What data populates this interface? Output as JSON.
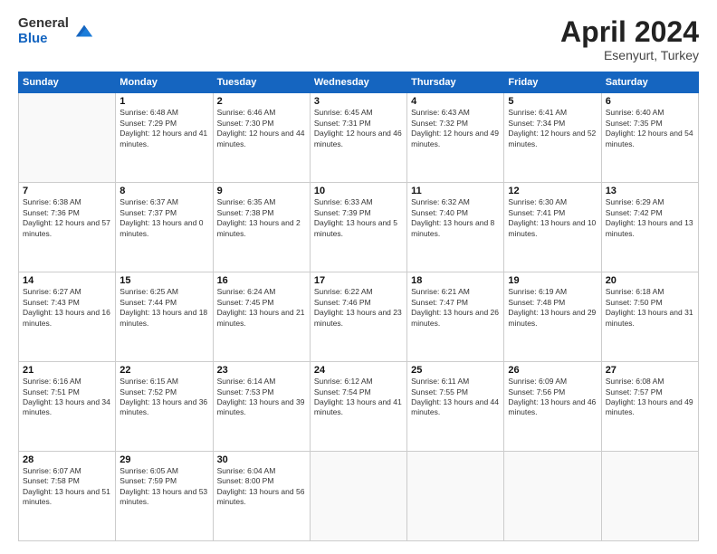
{
  "header": {
    "logo_general": "General",
    "logo_blue": "Blue",
    "title": "April 2024",
    "location": "Esenyurt, Turkey"
  },
  "days_of_week": [
    "Sunday",
    "Monday",
    "Tuesday",
    "Wednesday",
    "Thursday",
    "Friday",
    "Saturday"
  ],
  "weeks": [
    [
      {
        "day": "",
        "sunrise": "",
        "sunset": "",
        "daylight": ""
      },
      {
        "day": "1",
        "sunrise": "Sunrise: 6:48 AM",
        "sunset": "Sunset: 7:29 PM",
        "daylight": "Daylight: 12 hours and 41 minutes."
      },
      {
        "day": "2",
        "sunrise": "Sunrise: 6:46 AM",
        "sunset": "Sunset: 7:30 PM",
        "daylight": "Daylight: 12 hours and 44 minutes."
      },
      {
        "day": "3",
        "sunrise": "Sunrise: 6:45 AM",
        "sunset": "Sunset: 7:31 PM",
        "daylight": "Daylight: 12 hours and 46 minutes."
      },
      {
        "day": "4",
        "sunrise": "Sunrise: 6:43 AM",
        "sunset": "Sunset: 7:32 PM",
        "daylight": "Daylight: 12 hours and 49 minutes."
      },
      {
        "day": "5",
        "sunrise": "Sunrise: 6:41 AM",
        "sunset": "Sunset: 7:34 PM",
        "daylight": "Daylight: 12 hours and 52 minutes."
      },
      {
        "day": "6",
        "sunrise": "Sunrise: 6:40 AM",
        "sunset": "Sunset: 7:35 PM",
        "daylight": "Daylight: 12 hours and 54 minutes."
      }
    ],
    [
      {
        "day": "7",
        "sunrise": "Sunrise: 6:38 AM",
        "sunset": "Sunset: 7:36 PM",
        "daylight": "Daylight: 12 hours and 57 minutes."
      },
      {
        "day": "8",
        "sunrise": "Sunrise: 6:37 AM",
        "sunset": "Sunset: 7:37 PM",
        "daylight": "Daylight: 13 hours and 0 minutes."
      },
      {
        "day": "9",
        "sunrise": "Sunrise: 6:35 AM",
        "sunset": "Sunset: 7:38 PM",
        "daylight": "Daylight: 13 hours and 2 minutes."
      },
      {
        "day": "10",
        "sunrise": "Sunrise: 6:33 AM",
        "sunset": "Sunset: 7:39 PM",
        "daylight": "Daylight: 13 hours and 5 minutes."
      },
      {
        "day": "11",
        "sunrise": "Sunrise: 6:32 AM",
        "sunset": "Sunset: 7:40 PM",
        "daylight": "Daylight: 13 hours and 8 minutes."
      },
      {
        "day": "12",
        "sunrise": "Sunrise: 6:30 AM",
        "sunset": "Sunset: 7:41 PM",
        "daylight": "Daylight: 13 hours and 10 minutes."
      },
      {
        "day": "13",
        "sunrise": "Sunrise: 6:29 AM",
        "sunset": "Sunset: 7:42 PM",
        "daylight": "Daylight: 13 hours and 13 minutes."
      }
    ],
    [
      {
        "day": "14",
        "sunrise": "Sunrise: 6:27 AM",
        "sunset": "Sunset: 7:43 PM",
        "daylight": "Daylight: 13 hours and 16 minutes."
      },
      {
        "day": "15",
        "sunrise": "Sunrise: 6:25 AM",
        "sunset": "Sunset: 7:44 PM",
        "daylight": "Daylight: 13 hours and 18 minutes."
      },
      {
        "day": "16",
        "sunrise": "Sunrise: 6:24 AM",
        "sunset": "Sunset: 7:45 PM",
        "daylight": "Daylight: 13 hours and 21 minutes."
      },
      {
        "day": "17",
        "sunrise": "Sunrise: 6:22 AM",
        "sunset": "Sunset: 7:46 PM",
        "daylight": "Daylight: 13 hours and 23 minutes."
      },
      {
        "day": "18",
        "sunrise": "Sunrise: 6:21 AM",
        "sunset": "Sunset: 7:47 PM",
        "daylight": "Daylight: 13 hours and 26 minutes."
      },
      {
        "day": "19",
        "sunrise": "Sunrise: 6:19 AM",
        "sunset": "Sunset: 7:48 PM",
        "daylight": "Daylight: 13 hours and 29 minutes."
      },
      {
        "day": "20",
        "sunrise": "Sunrise: 6:18 AM",
        "sunset": "Sunset: 7:50 PM",
        "daylight": "Daylight: 13 hours and 31 minutes."
      }
    ],
    [
      {
        "day": "21",
        "sunrise": "Sunrise: 6:16 AM",
        "sunset": "Sunset: 7:51 PM",
        "daylight": "Daylight: 13 hours and 34 minutes."
      },
      {
        "day": "22",
        "sunrise": "Sunrise: 6:15 AM",
        "sunset": "Sunset: 7:52 PM",
        "daylight": "Daylight: 13 hours and 36 minutes."
      },
      {
        "day": "23",
        "sunrise": "Sunrise: 6:14 AM",
        "sunset": "Sunset: 7:53 PM",
        "daylight": "Daylight: 13 hours and 39 minutes."
      },
      {
        "day": "24",
        "sunrise": "Sunrise: 6:12 AM",
        "sunset": "Sunset: 7:54 PM",
        "daylight": "Daylight: 13 hours and 41 minutes."
      },
      {
        "day": "25",
        "sunrise": "Sunrise: 6:11 AM",
        "sunset": "Sunset: 7:55 PM",
        "daylight": "Daylight: 13 hours and 44 minutes."
      },
      {
        "day": "26",
        "sunrise": "Sunrise: 6:09 AM",
        "sunset": "Sunset: 7:56 PM",
        "daylight": "Daylight: 13 hours and 46 minutes."
      },
      {
        "day": "27",
        "sunrise": "Sunrise: 6:08 AM",
        "sunset": "Sunset: 7:57 PM",
        "daylight": "Daylight: 13 hours and 49 minutes."
      }
    ],
    [
      {
        "day": "28",
        "sunrise": "Sunrise: 6:07 AM",
        "sunset": "Sunset: 7:58 PM",
        "daylight": "Daylight: 13 hours and 51 minutes."
      },
      {
        "day": "29",
        "sunrise": "Sunrise: 6:05 AM",
        "sunset": "Sunset: 7:59 PM",
        "daylight": "Daylight: 13 hours and 53 minutes."
      },
      {
        "day": "30",
        "sunrise": "Sunrise: 6:04 AM",
        "sunset": "Sunset: 8:00 PM",
        "daylight": "Daylight: 13 hours and 56 minutes."
      },
      {
        "day": "",
        "sunrise": "",
        "sunset": "",
        "daylight": ""
      },
      {
        "day": "",
        "sunrise": "",
        "sunset": "",
        "daylight": ""
      },
      {
        "day": "",
        "sunrise": "",
        "sunset": "",
        "daylight": ""
      },
      {
        "day": "",
        "sunrise": "",
        "sunset": "",
        "daylight": ""
      }
    ]
  ]
}
